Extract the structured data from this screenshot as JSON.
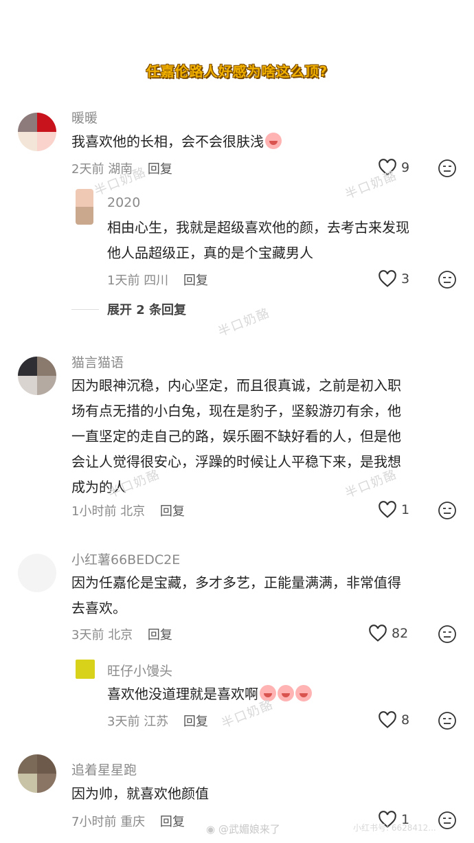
{
  "header": {
    "title": "任嘉伦路人好感为啥这么顶?"
  },
  "comments": [
    {
      "name": "暖暖",
      "text": "我喜欢他的长相，会不会很肤浅",
      "time": "2天前",
      "location": "湖南",
      "reply_label": "回复",
      "likes": "9",
      "avatar_colors": [
        "#8d7a7a",
        "#c8121c",
        "#f3e6d8",
        "#f9d3cc"
      ],
      "replies": [
        {
          "name": "2020",
          "text_lines": [
            "相由心生，我就是超级喜欢他的颜，去考古来发现",
            "他人品超级正，真的是个宝藏男人"
          ],
          "time": "1天前",
          "location": "四川",
          "reply_label": "回复",
          "likes": "3",
          "avatar_colors": [
            "#f0c9b4",
            "#c9a88e"
          ]
        }
      ],
      "expand_label": "展开 2 条回复"
    },
    {
      "name": "猫言猫语",
      "text_lines": [
        "因为眼神沉稳，内心坚定，而且很真诚，之前是初入职",
        "场有点无措的小白兔，现在是豹子，坚毅游刃有余，他",
        "一直坚定的走自己的路，娱乐圈不缺好看的人，但是他",
        "会让人觉得很安心，浮躁的时候让人平稳下来，是我想",
        "成为的人"
      ],
      "time": "1小时前",
      "location": "北京",
      "reply_label": "回复",
      "likes": "1",
      "avatar_colors": [
        "#2e2e33",
        "#8a7a6e",
        "#d9d4cf",
        "#b4aaa2"
      ]
    },
    {
      "name": "小红薯66BEDC2E",
      "text_lines": [
        "因为任嘉伦是宝藏，多才多艺，正能量满满，非常值得",
        "去喜欢。"
      ],
      "time": "3天前",
      "location": "北京",
      "reply_label": "回复",
      "likes": "82",
      "avatar_colors": [
        "#f4f4f4",
        "#f4f4f4",
        "#f4f4f4",
        "#f4f4f4"
      ],
      "replies": [
        {
          "name": "旺仔小馒头",
          "text": "喜欢他没道理就是喜欢啊",
          "time": "3天前",
          "location": "江苏",
          "reply_label": "回复",
          "likes": "8",
          "avatar_colors": [
            "#d8d21a"
          ]
        }
      ]
    },
    {
      "name": "追着星星跑",
      "text": "因为帅，就喜欢他颜值",
      "time": "7小时前",
      "location": "重庆",
      "reply_label": "回复",
      "likes": "1",
      "avatar_colors": [
        "#7b6a58",
        "#6e5a4a",
        "#c8c2a6",
        "#8a7565"
      ]
    }
  ],
  "watermark": {
    "text": "半口奶酪"
  },
  "footer": {
    "weibo": "@武媚娘来了",
    "xhs": "小红书号: 6628412..."
  },
  "icons": {
    "like": "heart-outline-icon",
    "dislike": "meh-face-icon",
    "weibo": "weibo-logo-icon"
  }
}
